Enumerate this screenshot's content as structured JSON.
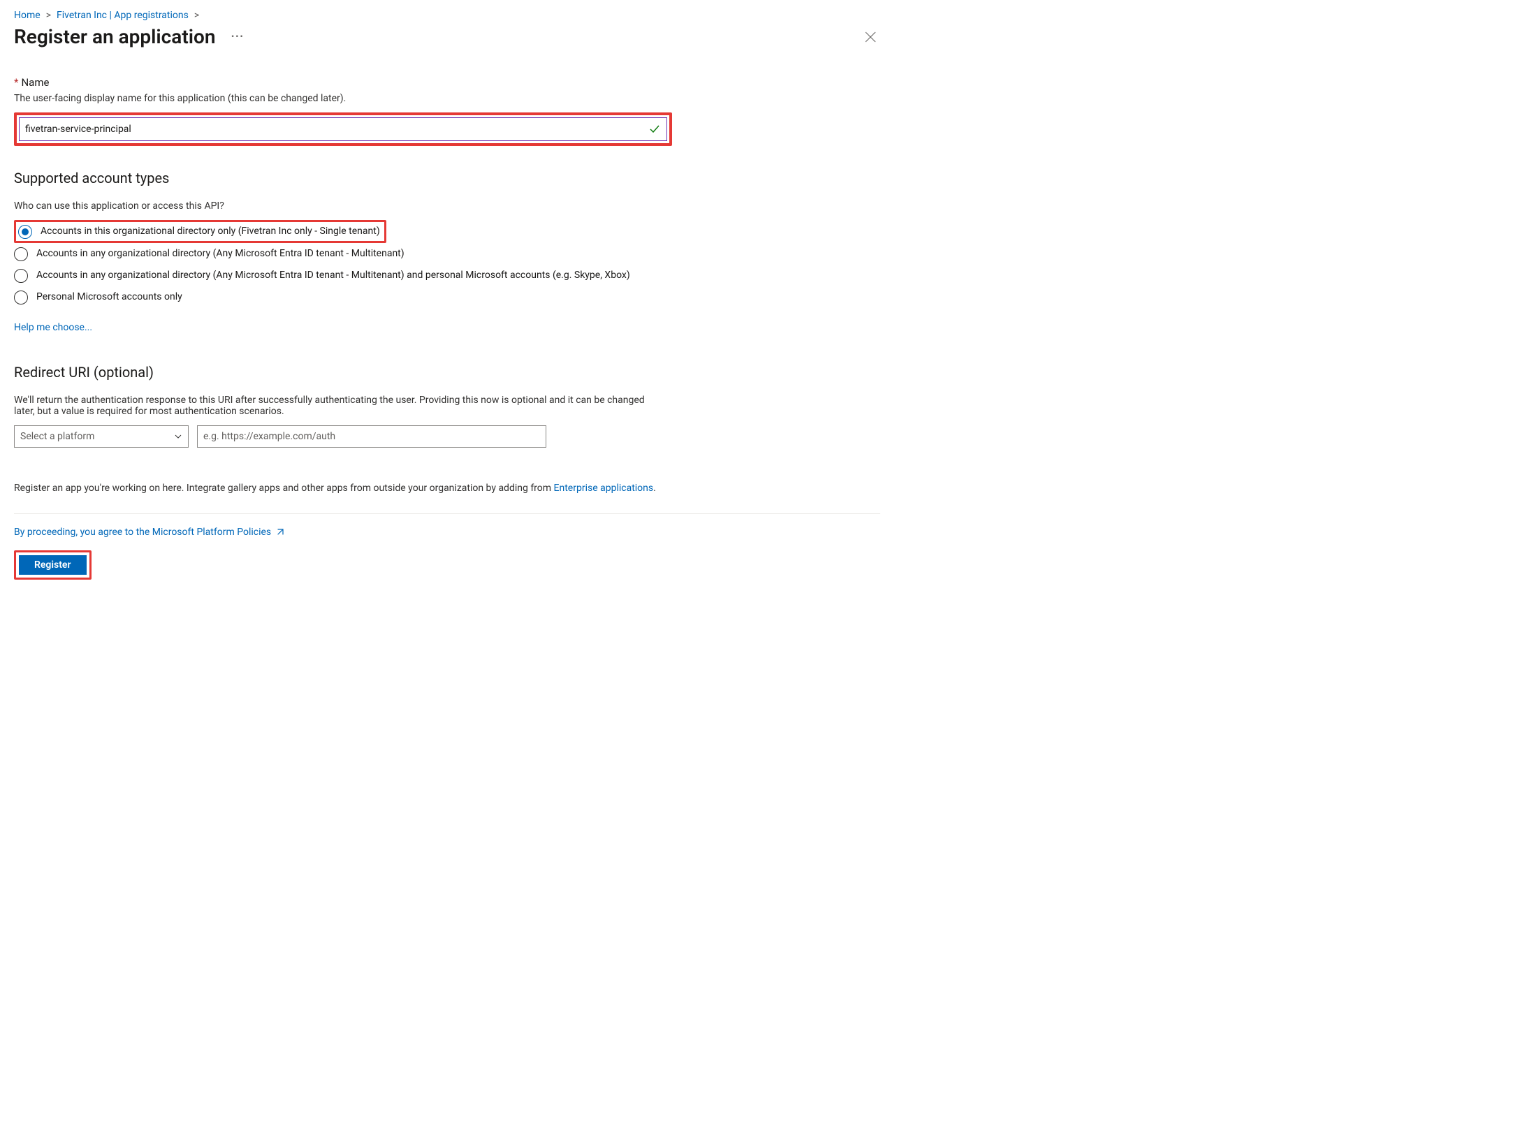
{
  "breadcrumb": {
    "home": "Home",
    "middle": "Fivetran Inc | App registrations"
  },
  "title": "Register an application",
  "name_section": {
    "label": "Name",
    "subtext": "The user-facing display name for this application (this can be changed later).",
    "value": "fivetran-service-principal"
  },
  "account_types": {
    "heading": "Supported account types",
    "subtext": "Who can use this application or access this API?",
    "options": [
      "Accounts in this organizational directory only (Fivetran Inc only - Single tenant)",
      "Accounts in any organizational directory (Any Microsoft Entra ID tenant - Multitenant)",
      "Accounts in any organizational directory (Any Microsoft Entra ID tenant - Multitenant) and personal Microsoft accounts (e.g. Skype, Xbox)",
      "Personal Microsoft accounts only"
    ],
    "help_link": "Help me choose..."
  },
  "redirect": {
    "heading": "Redirect URI (optional)",
    "subtext": "We'll return the authentication response to this URI after successfully authenticating the user. Providing this now is optional and it can be changed later, but a value is required for most authentication scenarios.",
    "platform_placeholder": "Select a platform",
    "uri_placeholder": "e.g. https://example.com/auth"
  },
  "info": {
    "text_before": "Register an app you're working on here. Integrate gallery apps and other apps from outside your organization by adding from ",
    "link": "Enterprise applications",
    "text_after": "."
  },
  "policies_link": "By proceeding, you agree to the Microsoft Platform Policies",
  "register_label": "Register"
}
